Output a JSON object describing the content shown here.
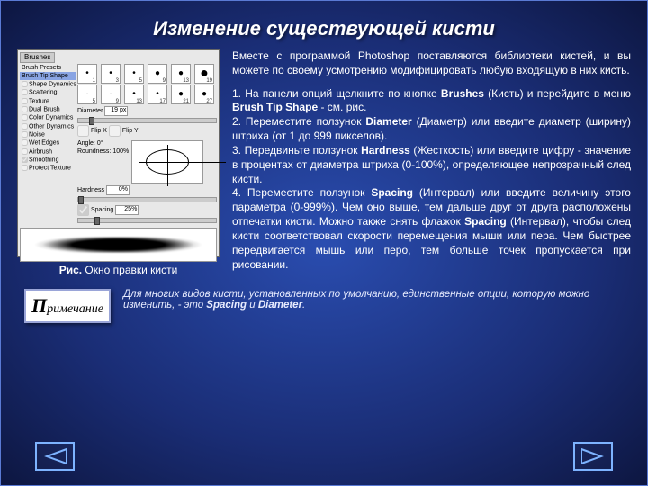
{
  "title": "Изменение существующей кисти",
  "panel": {
    "tab": "Brushes",
    "top_item": "Brush Presets",
    "sidebar": [
      "Brush Tip Shape",
      "Shape Dynamics",
      "Scattering",
      "Texture",
      "Dual Brush",
      "Color Dynamics",
      "Other Dynamics",
      "Noise",
      "Wet Edges",
      "Airbrush",
      "Smoothing",
      "Protect Texture"
    ],
    "tip_labels": [
      "1",
      "3",
      "5",
      "9",
      "13",
      "19",
      "5",
      "9",
      "13",
      "17",
      "21",
      "27"
    ],
    "diameter_label": "Diameter",
    "diameter_value": "19 px",
    "flipx": "Flip X",
    "flipy": "Flip Y",
    "angle_label": "Angle:",
    "angle_value": "0°",
    "roundness_label": "Roundness:",
    "roundness_value": "100%",
    "hardness_label": "Hardness",
    "hardness_value": "0%",
    "spacing_label": "Spacing",
    "spacing_value": "25%"
  },
  "caption_prefix": "Рис.",
  "caption_text": "Окно правки кисти",
  "intro": "Вместе с программой Photoshop поставляются библиотеки кистей, и вы можете по своему усмотрению модифицировать любую входящую в них кисть.",
  "step1a": "1. На панели опций щелкните по кнопке ",
  "step1b": "Brushes",
  "step1c": " (Кисть) и перейдите в меню ",
  "step1d": "Brush Tip Shape",
  "step1e": " - см. рис.",
  "step2a": "2. Переместите ползунок ",
  "step2b": "Diameter",
  "step2c": " (Диаметр) или введите диаметр (ширину) штриха (от 1 до 999 пикселов).",
  "step3a": "3. Передвиньте ползунок ",
  "step3b": "Hardness",
  "step3c": " (Жесткость) или введите цифру - значение в процентах от диаметра штриха (0-100%), определяющее непрозрачный след кисти.",
  "step4a": "4. Переместите ползунок ",
  "step4b": "Spacing",
  "step4c": " (Интервал) или введите величину этого параметра (0-999%). Чем оно выше, тем дальше друг от друга расположены отпечатки кисти. Можно также снять флажок ",
  "step4d": "Spacing",
  "step4e": " (Интервал), чтобы след кисти соответствовал скорости перемещения мыши или пера. Чем быстрее передвигается мышь или перо, тем больше точек пропускается при рисовании.",
  "note_label_big": "П",
  "note_label_rest": "римечание",
  "note_a": "Для многих видов кисти, установленных по умолчанию, единственные опции, которую можно изменить, - это ",
  "note_b": "Spacing",
  "note_c": " и ",
  "note_d": "Diameter",
  "note_e": "."
}
